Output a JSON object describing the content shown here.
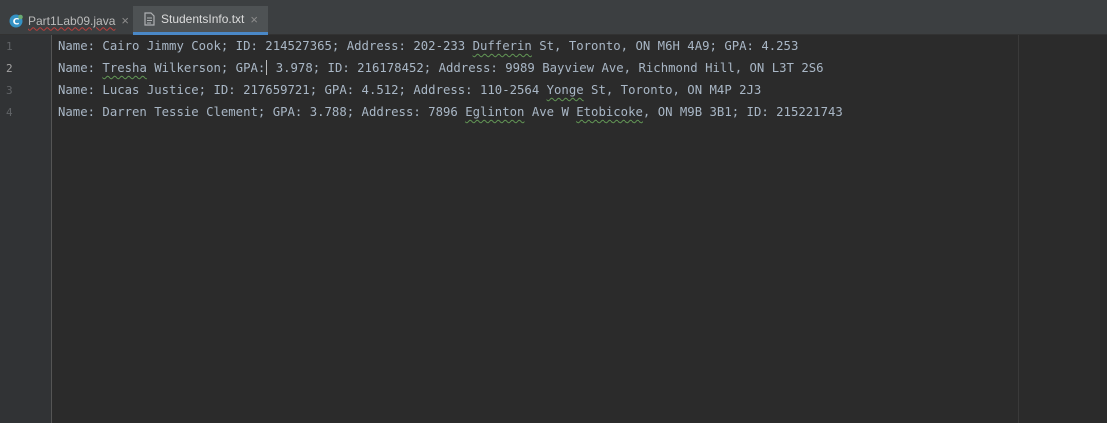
{
  "tabs": [
    {
      "label": "Part1Lab09.java",
      "icon": "java-class-icon",
      "active": false,
      "has_error": true
    },
    {
      "label": "StudentsInfo.txt",
      "icon": "text-file-icon",
      "active": true,
      "has_error": false
    }
  ],
  "tab_close_glyph": "×",
  "gutter": {
    "line_numbers": [
      "1",
      "2",
      "3",
      "4"
    ],
    "current_line": "2"
  },
  "editor": {
    "lines": [
      "Name: Cairo Jimmy Cook; ID: 214527365; Address: 202-233 Dufferin St, Toronto, ON M6H 4A9; GPA: 4.253",
      "Name: Tresha Wilkerson; GPA: 3.978; ID: 216178452; Address: 9989 Bayview Ave, Richmond Hill, ON L3T 2S6",
      "Name: Lucas Justice; ID: 217659721; GPA: 4.512; Address: 110-2564 Yonge St, Toronto, ON M4P 2J3",
      "Name: Darren Tessie Clement; GPA: 3.788; Address: 7896 Eglinton Ave W Etobicoke, ON M9B 3B1; ID: 215221743"
    ],
    "line1_parts": [
      "Name: Cairo Jimmy Cook; ID: 214527365; Address: 202-233 ",
      "Dufferin",
      " St, Toronto, ON M6H 4A9; GPA: 4.253"
    ],
    "line2_parts": [
      "Name: ",
      "Tresha",
      " Wilkerson; GPA:",
      " 3.978; ID: 216178452; Address: 9989 Bayview Ave, Richmond Hill, ON L3T 2S6"
    ],
    "line3_parts": [
      "Name: Lucas Justice; ID: 217659721; GPA: 4.512; Address: 110-2564 ",
      "Yonge",
      " St, Toronto, ON M4P 2J3"
    ],
    "line4_parts": [
      "Name: Darren Tessie Clement; GPA: 3.788; Address: 7896 ",
      "Eglinton",
      " Ave W ",
      "Etobicoke",
      ", ON M9B 3B1; ID: 215221743"
    ]
  },
  "colors": {
    "editor_bg": "#2b2b2b",
    "gutter_bg": "#313335",
    "text": "#a9b7c6",
    "active_tab_underline": "#4a88c7",
    "spellcheck_underline": "#629755",
    "error_underline": "#bc3f3c"
  }
}
